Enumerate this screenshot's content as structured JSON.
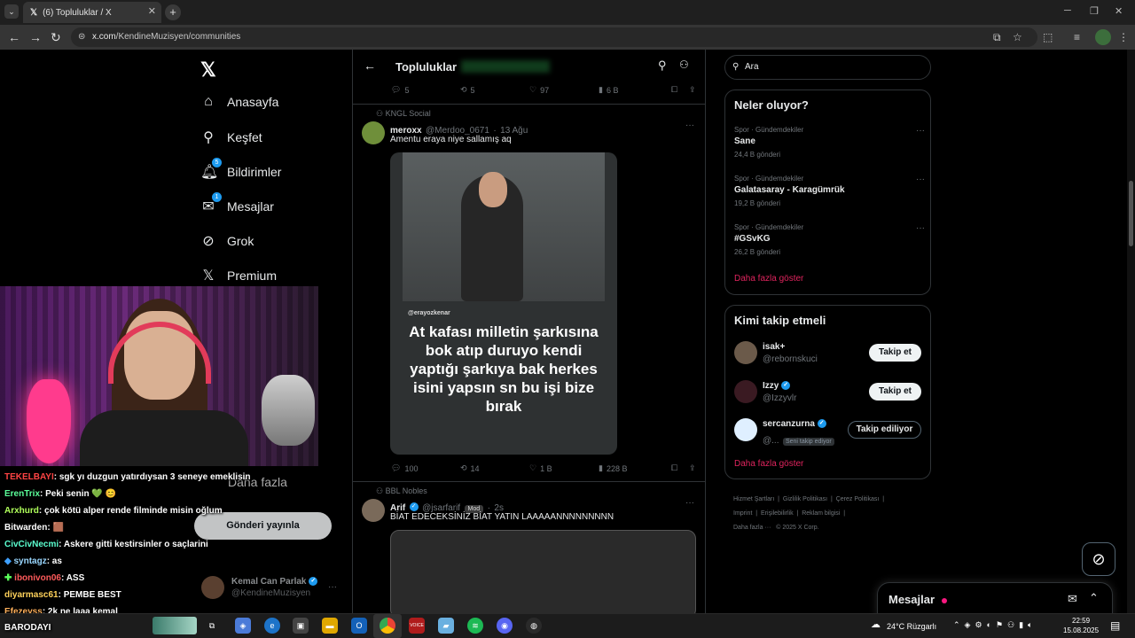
{
  "browser": {
    "tab_title": "(6) Topluluklar / X",
    "url_domain": "x.com",
    "url_path": "/KendineMuzisyen/communities"
  },
  "sidebar": {
    "items": [
      {
        "label": "Anasayfa",
        "icon": "home-icon"
      },
      {
        "label": "Keşfet",
        "icon": "search-icon"
      },
      {
        "label": "Bildirimler",
        "icon": "bell-icon",
        "badge": "5"
      },
      {
        "label": "Mesajlar",
        "icon": "mail-icon",
        "badge": "1"
      },
      {
        "label": "Grok",
        "icon": "grok-icon"
      },
      {
        "label": "Premium",
        "icon": "x-icon"
      },
      {
        "label": "Daha fazla",
        "icon": "more-icon"
      }
    ],
    "post_button": "Gönderi yayınla",
    "account": {
      "name": "Kemal Can Parlak",
      "handle": "@KendineMuzisyen"
    }
  },
  "header": {
    "title": "Topluluklar"
  },
  "feed": {
    "top_actions": {
      "replies": "5",
      "reposts": "5",
      "likes": "97",
      "views": "6 B"
    },
    "posts": [
      {
        "community": "KNGL Social",
        "name": "meroxx",
        "handle": "@Merdoo_0671",
        "time": "13 Ağu",
        "text": "Amentu eraya niye sallamış aq",
        "media_tag": "@erayozkenar",
        "media_caption": "At kafası milletin şarkısına bok atıp duruyo kendi yaptığı şarkıya bak herkes isini yapsın sn bu işi bize bırak",
        "replies": "100",
        "reposts": "14",
        "likes": "1 B",
        "views": "228 B"
      },
      {
        "community": "BBL Nobles",
        "name": "Arif",
        "handle": "@jsarfarif",
        "badge": "Mod",
        "time": "2s",
        "text": "BİAT EDECEKSİNİZ BİAT YATIN LAAAAANNNNNNNNN"
      }
    ]
  },
  "right": {
    "search_placeholder": "Ara",
    "trends_title": "Neler oluyor?",
    "trends": [
      {
        "category": "Spor · Gündemdekiler",
        "name": "Sane",
        "count": "24,4 B gönderi"
      },
      {
        "category": "Spor · Gündemdekiler",
        "name": "Galatasaray - Karagümrük",
        "count": "19,2 B gönderi"
      },
      {
        "category": "Spor · Gündemdekiler",
        "name": "#GSvKG",
        "count": "26,2 B gönderi"
      }
    ],
    "trends_more": "Daha fazla göster",
    "who_title": "Kimi takip etmeli",
    "who": [
      {
        "name": "isak+",
        "handle": "@rebornskuci",
        "button": "Takip et"
      },
      {
        "name": "Izzy",
        "handle": "@Izzyvlr",
        "button": "Takip et"
      },
      {
        "name": "sercanzurna",
        "handle": "@...",
        "follows_you": "Seni takip ediyor",
        "button": "Takip ediliyor"
      }
    ],
    "who_more": "Daha fazla göster",
    "footer": [
      "Hizmet Şartları",
      "Gizlilik Politikası",
      "Çerez Politikası",
      "Imprint",
      "Erişilebilirlik",
      "Reklam bilgisi",
      "Daha fazla ···",
      "© 2025 X Corp."
    ]
  },
  "messages_dock": {
    "title": "Mesajlar"
  },
  "chat": [
    {
      "user": "TEKELBAYI",
      "color": "#ff4444",
      "msg": ": sgk yı duzgun yatırdıysan 3 seneye emeklisin"
    },
    {
      "user": "ErenTrix",
      "color": "#5bff9a",
      "msg": ": Peki senin 💚 😊"
    },
    {
      "user": "Arxhurd",
      "color": "#b0ff5b",
      "msg": ": çok kötü alper rende filminde misin oğlum"
    },
    {
      "user": "Bitwarden",
      "color": "#ffffff",
      "msg": ": 🟫"
    },
    {
      "user": "CivCivNecmi",
      "color": "#5bffd0",
      "msg": ": Askere gitti kestirsinler o saçlarini"
    },
    {
      "user": "syntagz",
      "color": "#9ad7ff",
      "msg": ": as"
    },
    {
      "user": "ibonivon06",
      "color": "#ff5b5b",
      "msg": ": ASS"
    },
    {
      "user": "diyarmasc61",
      "color": "#ffd25b",
      "msg": ": PEMBE BEST"
    },
    {
      "user": "Efezeyss",
      "color": "#ffb05b",
      "msg": ": 2k ne laaa kemal"
    },
    {
      "user": "BARODAYI",
      "color": "#ffffff",
      "msg": ""
    }
  ],
  "taskbar": {
    "weather": "24°C  Rüzgarlı",
    "time": "22:59",
    "date": "15.08.2025"
  }
}
